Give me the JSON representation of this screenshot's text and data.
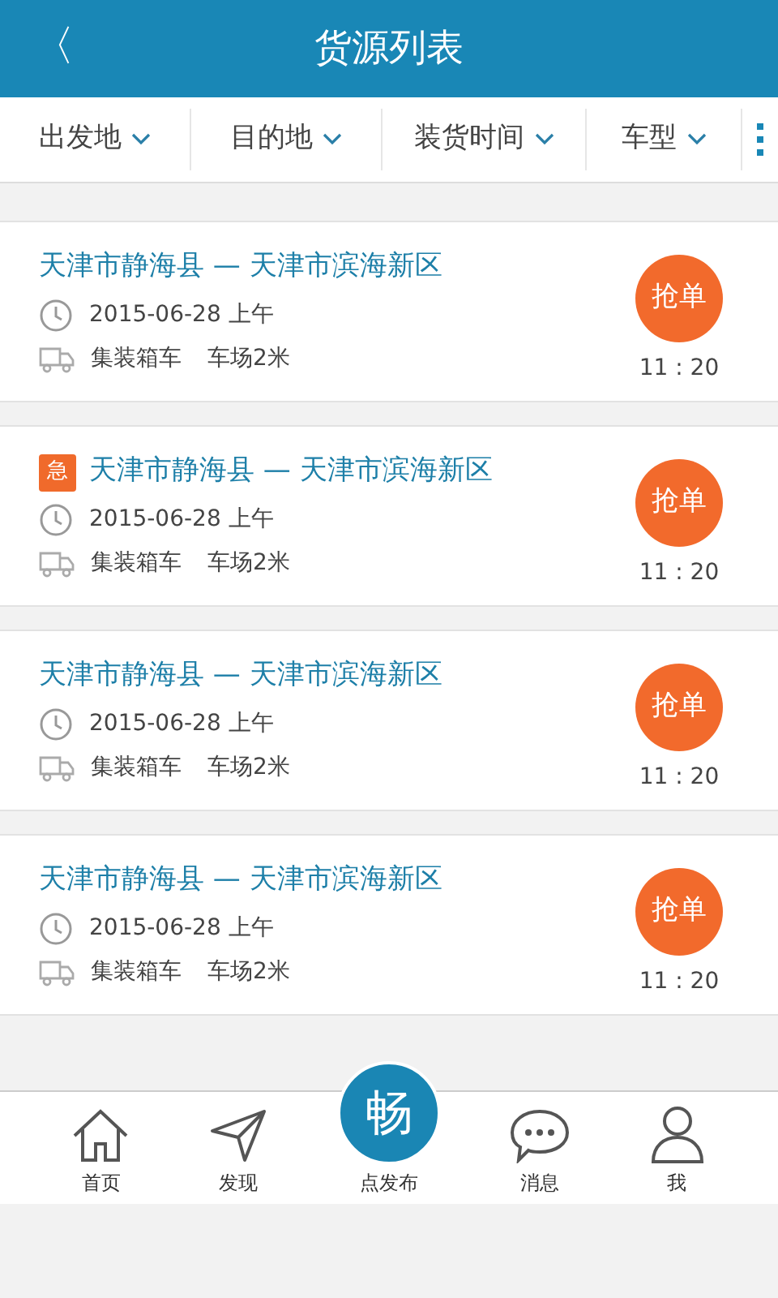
{
  "header": {
    "back": "〈",
    "title": "货源列表"
  },
  "filters": [
    {
      "label": "出发地"
    },
    {
      "label": "目的地"
    },
    {
      "label": "装货时间"
    },
    {
      "label": "车型"
    }
  ],
  "listings": [
    {
      "route": "天津市静海县 — 天津市滨海新区",
      "date": "2015-06-28 上午",
      "truck_type": "集装箱车",
      "length": "车场2米",
      "action": "抢单",
      "time": "11 : 20"
    },
    {
      "route": "天津市静海县 — 天津市滨海新区",
      "badge": "急",
      "date": "2015-06-28 上午",
      "truck_type": "集装箱车",
      "length": "车场2米",
      "action": "抢单",
      "time": "11 : 20"
    },
    {
      "route": "天津市静海县 — 天津市滨海新区",
      "date": "2015-06-28 上午",
      "truck_type": "集装箱车",
      "length": "车场2米",
      "action": "抢单",
      "time": "11 : 20"
    },
    {
      "route": "天津市静海县 — 天津市滨海新区",
      "date": "2015-06-28 上午",
      "truck_type": "集装箱车",
      "length": "车场2米",
      "action": "抢单",
      "time": "11 : 20"
    }
  ],
  "bottom_nav": [
    {
      "kind": "home",
      "label": "首页"
    },
    {
      "kind": "discover",
      "label": "发现"
    },
    {
      "kind": "publish",
      "label": "点发布",
      "mark": "畅"
    },
    {
      "kind": "messages",
      "label": "消息"
    },
    {
      "kind": "me",
      "label": "我"
    }
  ]
}
